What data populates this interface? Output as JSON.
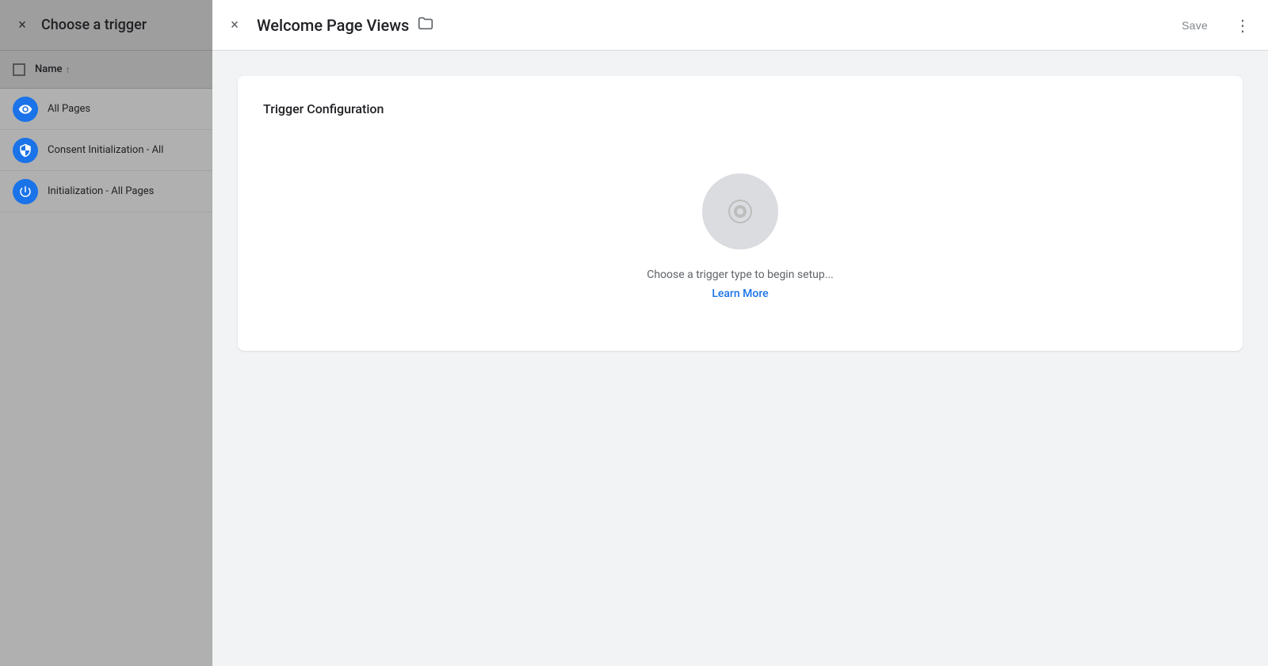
{
  "leftPanel": {
    "closeIcon": "×",
    "title": "Choose a trigger",
    "listHeader": {
      "label": "Name",
      "sortArrow": "↑"
    },
    "items": [
      {
        "id": "all-pages",
        "label": "All Pages",
        "iconType": "eye"
      },
      {
        "id": "consent-init",
        "label": "Consent Initialization - All",
        "iconType": "shield"
      },
      {
        "id": "initialization",
        "label": "Initialization - All Pages",
        "iconType": "power"
      }
    ]
  },
  "rightPanel": {
    "closeIcon": "×",
    "title": "Welcome Page Views",
    "folderIcon": "□",
    "actions": {
      "saveLabel": "Save",
      "moreIcon": "⋮"
    },
    "triggerConfig": {
      "sectionTitle": "Trigger Configuration",
      "placeholderText": "Choose a trigger type to begin setup...",
      "learnMoreLabel": "Learn More"
    }
  }
}
